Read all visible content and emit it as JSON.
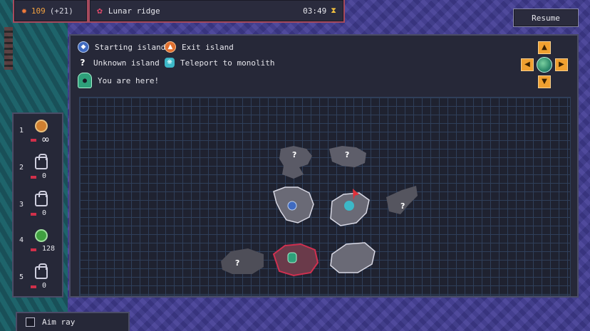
{
  "hud": {
    "resource_value": "109",
    "resource_delta": "(+21)",
    "location": "Lunar ridge",
    "timer": "03:49"
  },
  "resume_label": "Resume",
  "legend": {
    "starting": "Starting island",
    "exit": "Exit island",
    "unknown": "Unknown island",
    "teleport": "Teleport to monolith",
    "you": "You are here!",
    "unknown_symbol": "?"
  },
  "weapons": [
    {
      "slot": "1",
      "value": "∞",
      "state": "equipped-orange"
    },
    {
      "slot": "2",
      "value": "0",
      "state": "locked"
    },
    {
      "slot": "3",
      "value": "0",
      "state": "locked"
    },
    {
      "slot": "4",
      "value": "128",
      "state": "equipped-green"
    },
    {
      "slot": "5",
      "value": "0",
      "state": "locked"
    }
  ],
  "aim_ray_label": "Aim ray",
  "colors": {
    "accent_orange": "#f0a030",
    "panel": "#262838",
    "grid_line": "#2f3f5a",
    "current_island": "#d03050"
  },
  "icons": [
    "fire-icon",
    "flower-icon",
    "hourglass-icon",
    "starting-island-icon",
    "exit-island-icon",
    "unknown-island-icon",
    "teleport-icon",
    "player-icon",
    "globe-icon"
  ]
}
